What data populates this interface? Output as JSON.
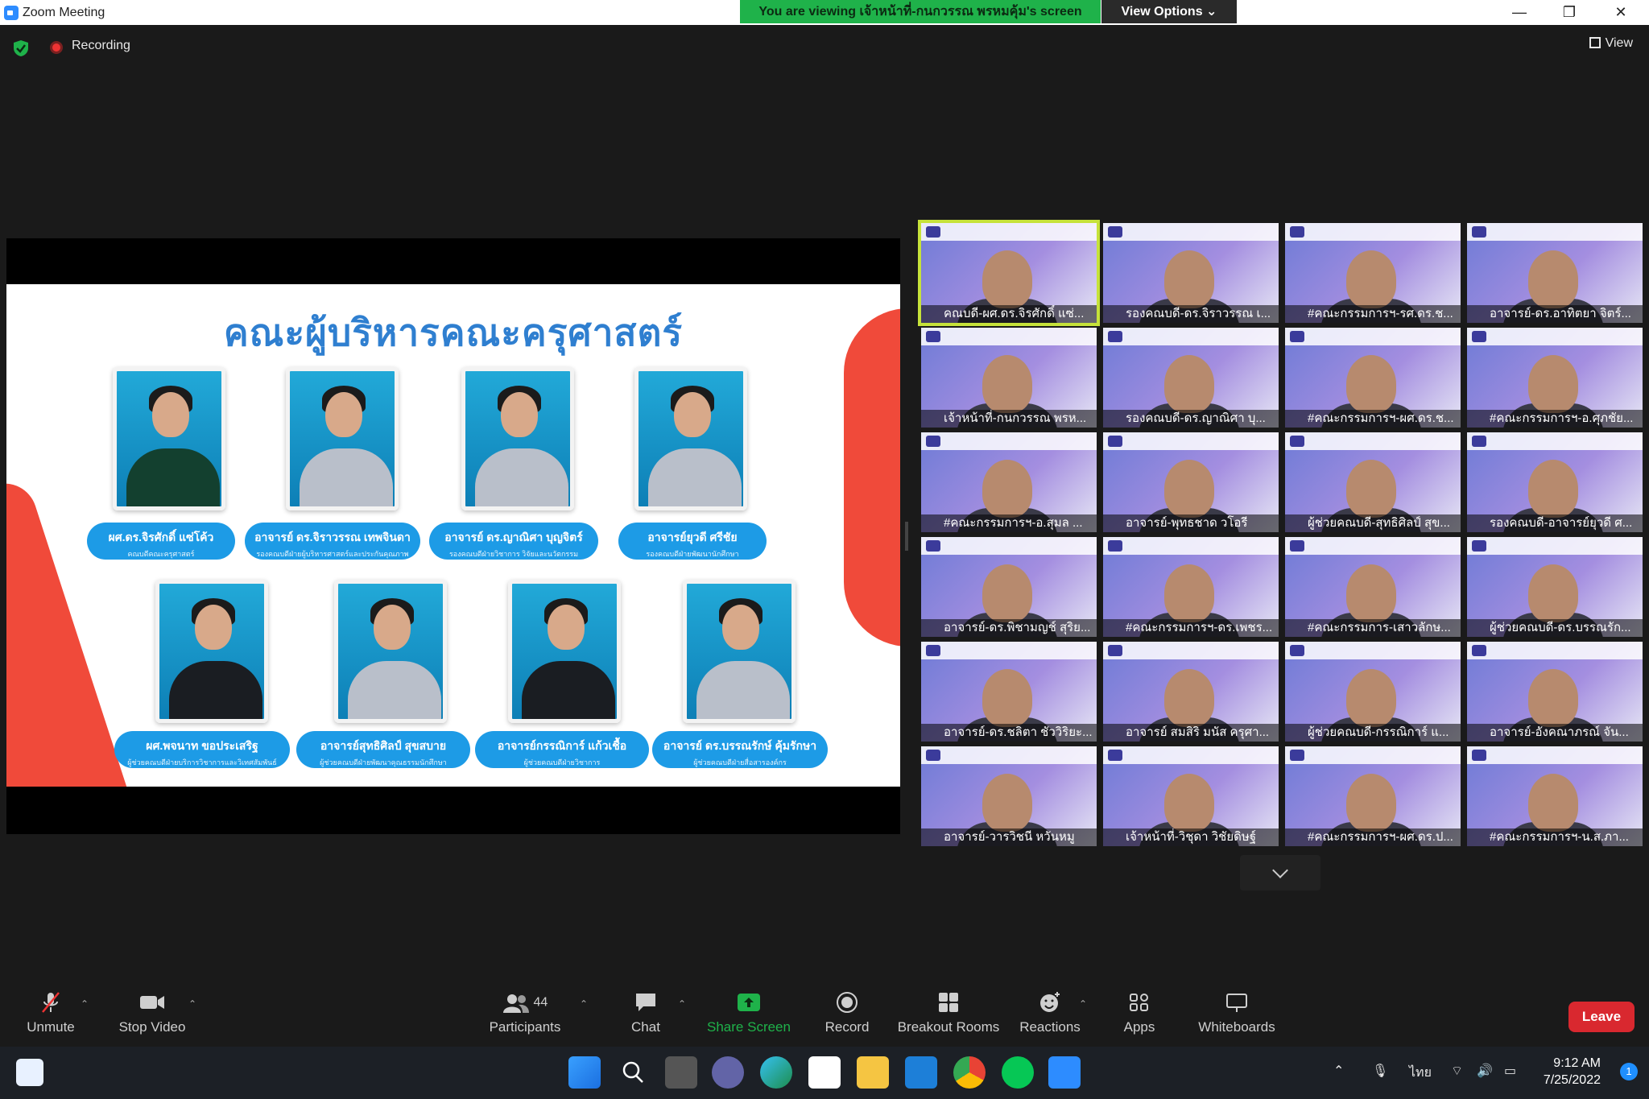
{
  "window": {
    "title": "Zoom Meeting",
    "minimize": "—",
    "restore": "❐",
    "close": "✕"
  },
  "banner": {
    "viewing_text": "You are viewing เจ้าหน้าที่-กนกวรรณ พรหมคุ้ม's screen",
    "view_options_label": "View Options ⌄"
  },
  "status": {
    "recording_label": "Recording",
    "view_label": "View"
  },
  "slide": {
    "title": "คณะผู้บริหารคณะครุศาสตร์",
    "people": [
      {
        "name": "ผศ.ดร.จิรศักดิ์ แซ่โค้ว",
        "role": "คณบดีคณะครุศาสตร์"
      },
      {
        "name": "อาจารย์ ดร.จิราวรรณ เทพจินดา",
        "role": "รองคณบดีฝ่ายผู้บริหารศาสตร์และประกันคุณภาพ"
      },
      {
        "name": "อาจารย์ ดร.ญาณิศา บุญจิตร์",
        "role": "รองคณบดีฝ่ายวิชาการ วิจัยและนวัตกรรม"
      },
      {
        "name": "อาจารย์ยุวดี ศรีชัย",
        "role": "รองคณบดีฝ่ายพัฒนานักศึกษา"
      },
      {
        "name": "ผศ.พจนาท ขอประเสริฐ",
        "role": "ผู้ช่วยคณบดีฝ่ายบริการวิชาการและวิเทศสัมพันธ์"
      },
      {
        "name": "อาจารย์สุทธิศิลป์ สุขสบาย",
        "role": "ผู้ช่วยคณบดีฝ่ายพัฒนาคุณธรรมนักศึกษา"
      },
      {
        "name": "อาจารย์กรรณิการ์ แก้วเชื้อ",
        "role": "ผู้ช่วยคณบดีฝ่ายวิชาการ"
      },
      {
        "name": "อาจารย์ ดร.บรรณรักษ์ คุ้มรักษา",
        "role": "ผู้ช่วยคณบดีฝ่ายสื่อสารองค์กร"
      }
    ]
  },
  "participants_tiles": [
    "คณบดี-ผศ.ดร.จิรศักดิ์ แซ่...",
    "รองคณบดี-ดร.จิราวรรณ เ...",
    "#คณะกรรมการฯ-รศ.ดร.ช...",
    "อาจารย์-ดร.อาทิตยา จิตร์...",
    "เจ้าหน้าที่-กนกวรรณ พรห...",
    "รองคณบดี-ดร.ญาณิศา บุ...",
    "#คณะกรรมการฯ-ผศ.ดร.ช...",
    "#คณะกรรมการฯ-อ.ศุภชัย...",
    "#คณะกรรมการฯ-อ.สุมล ...",
    "อาจารย์-พุทธชาด วโอรี",
    "ผู้ช่วยคณบดี-สุทธิศิลป์ สุข...",
    "รองคณบดี-อาจารย์ยุวดี ศ...",
    "อาจารย์-ดร.พิชามญช์ สุริย...",
    "#คณะกรรมการฯ-ดร.เพชร...",
    "#คณะกรรมการ-เสาวลักษ...",
    "ผู้ช่วยคณบดี-ดร.บรรณรัก...",
    "อาจารย์-ดร.ชลิตา ชัววิริยะ...",
    "อาจารย์ สมสิริ มนัส ครุศา...",
    "ผู้ช่วยคณบดี-กรรณิการ์ แ...",
    "อาจารย์-อังคณาภรณ์ จัน...",
    "อาจารย์-วารวิชนี หวันหมู",
    "เจ้าหน้าที่-วิชุดา วิชัยดิษฐ์",
    "#คณะกรรมการฯ-ผศ.ดร.ป...",
    "#คณะกรรมการฯ-น.ส.ภา..."
  ],
  "toolbar": {
    "unmute": "Unmute",
    "stop_video": "Stop Video",
    "participants": "Participants",
    "participants_count": "44",
    "chat": "Chat",
    "share_screen": "Share Screen",
    "record": "Record",
    "breakout_rooms": "Breakout Rooms",
    "reactions": "Reactions",
    "apps": "Apps",
    "whiteboards": "Whiteboards",
    "leave": "Leave"
  },
  "taskbar": {
    "time": "9:12 AM",
    "date": "7/25/2022",
    "language": "ไทย",
    "notification_count": "1"
  },
  "colors": {
    "accent_green": "#1fb24a",
    "leave_red": "#d9282f",
    "slide_blue": "#1d9be6",
    "active_tile": "#c6e23a"
  }
}
